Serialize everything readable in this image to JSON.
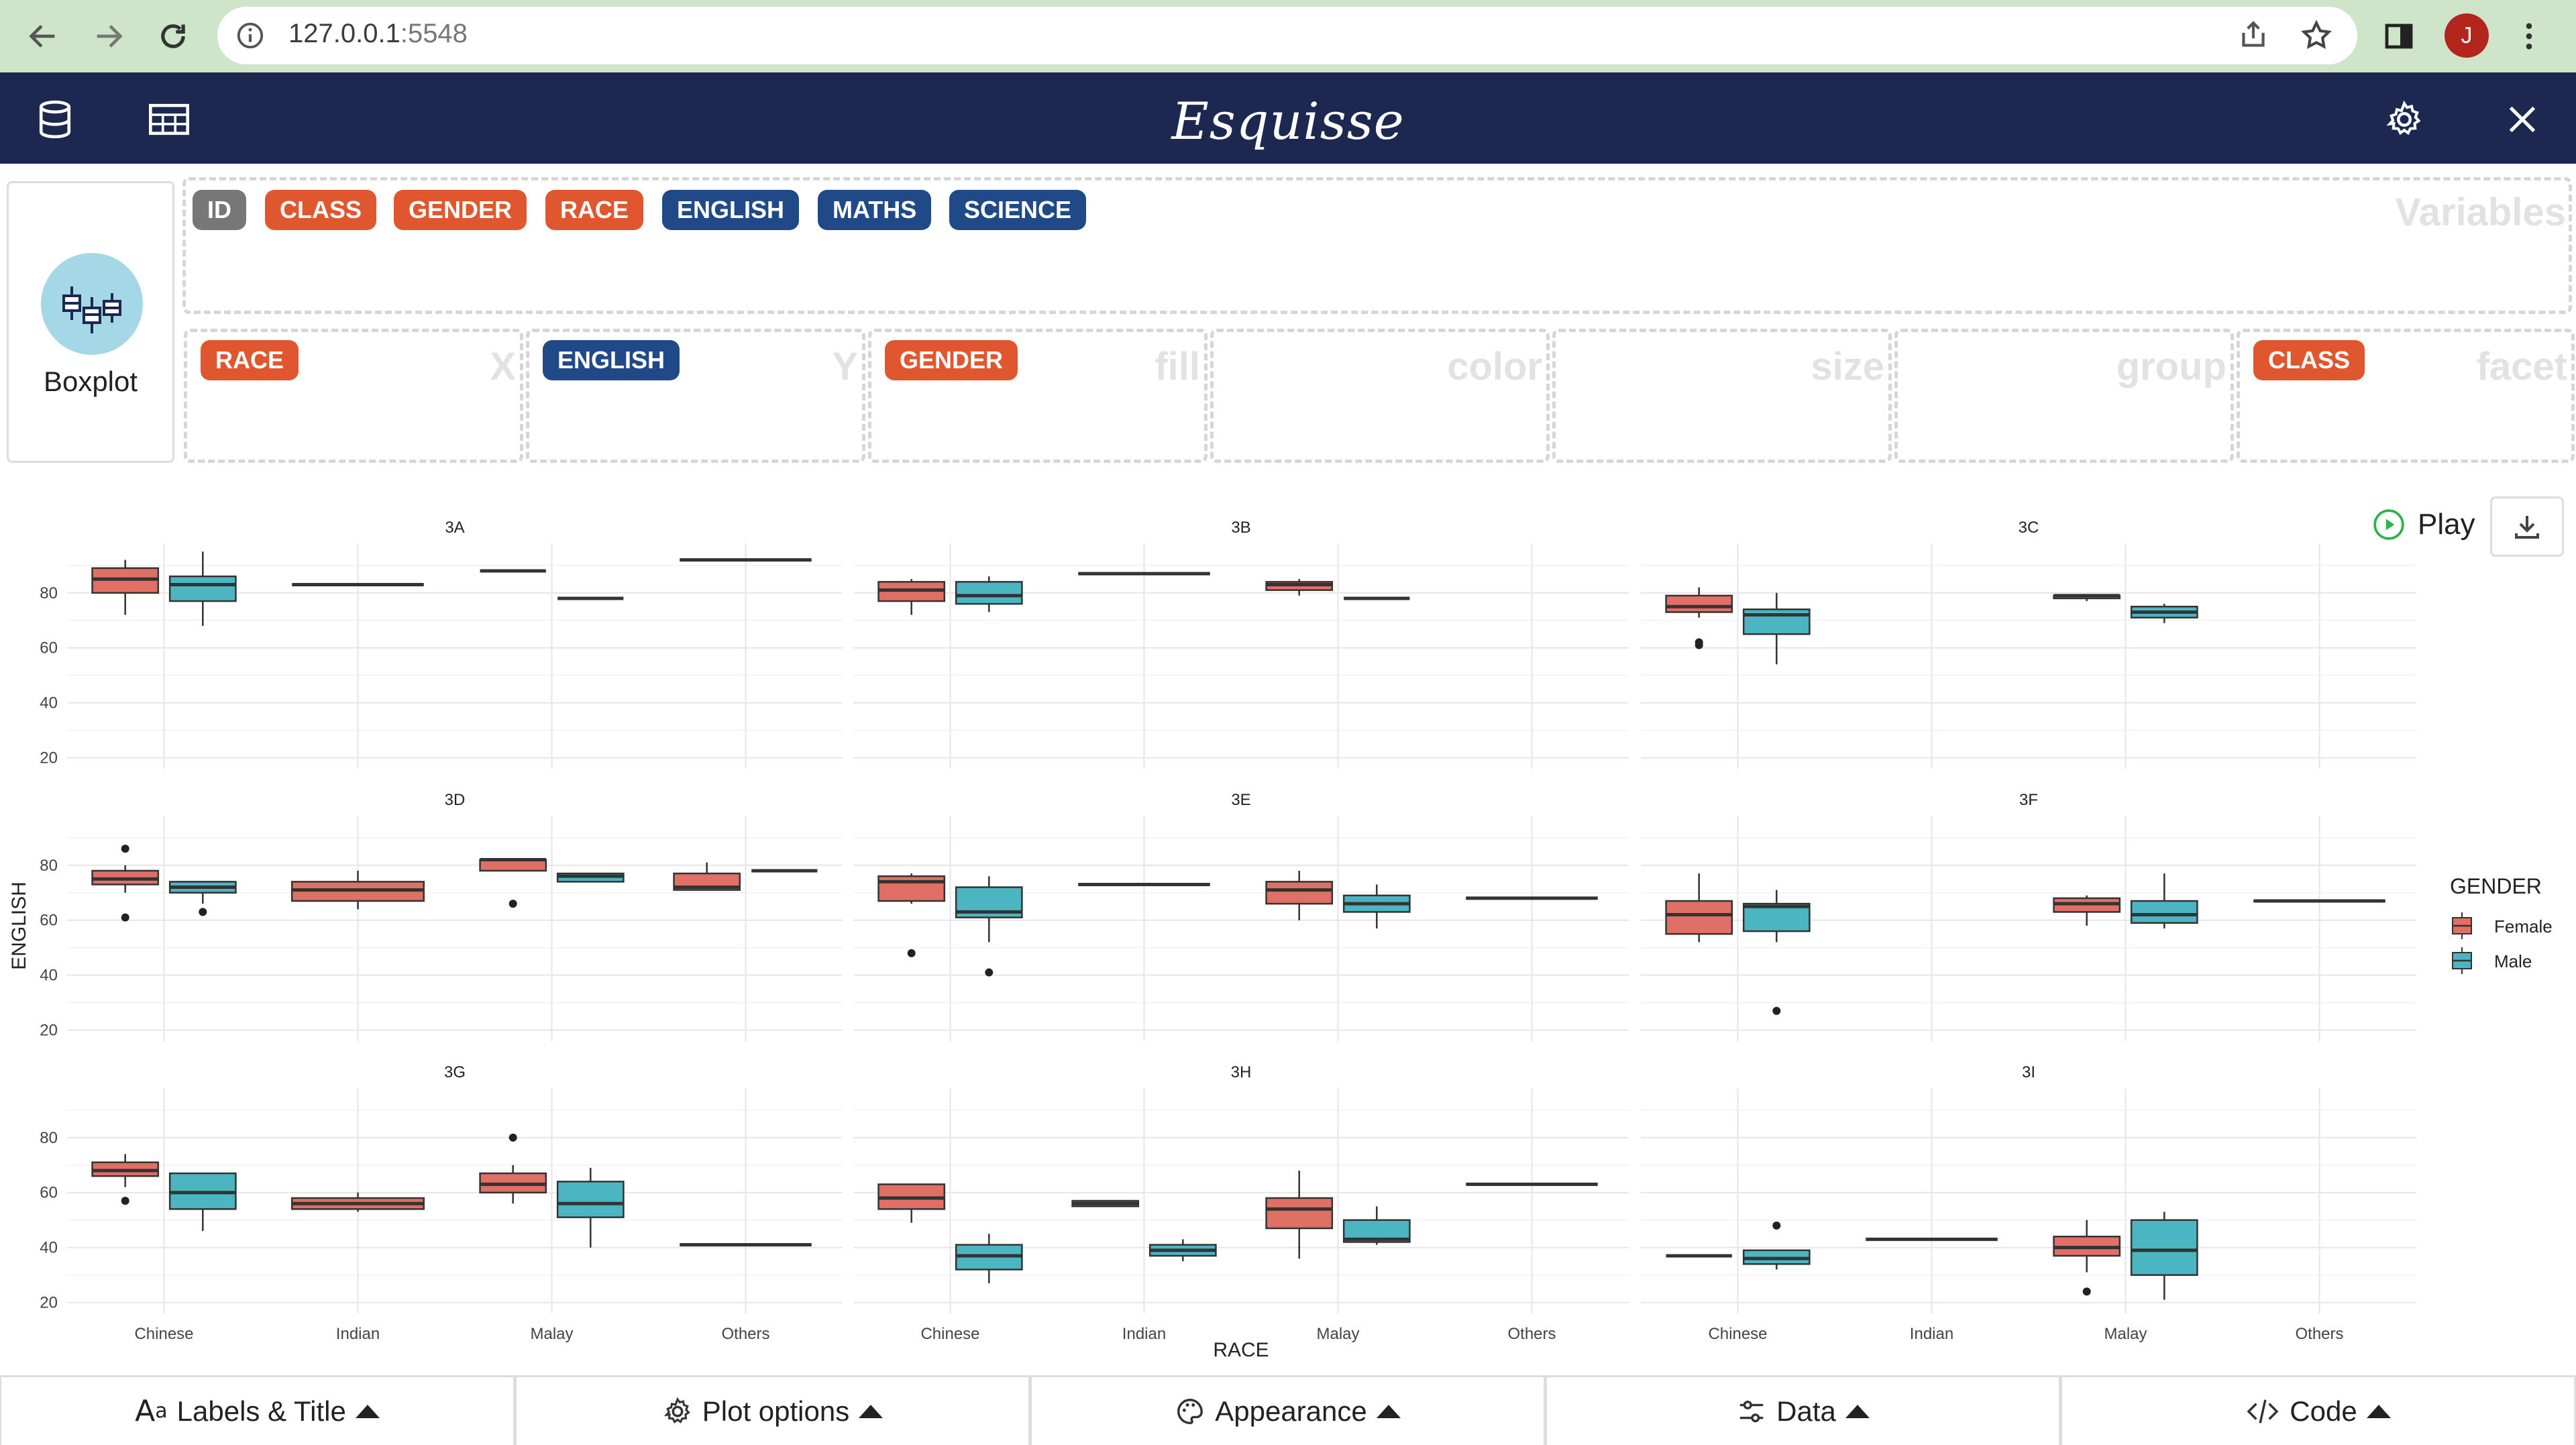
{
  "browser": {
    "url_host": "127.0.0.1",
    "url_port": ":5548",
    "avatar_letter": "J"
  },
  "app": {
    "title": "Esquisse"
  },
  "geom": {
    "label": "Boxplot"
  },
  "variables": {
    "title": "Variables",
    "items": [
      {
        "name": "ID",
        "kind": "id",
        "color": "#777777"
      },
      {
        "name": "CLASS",
        "kind": "discrete",
        "color": "#e0572f"
      },
      {
        "name": "GENDER",
        "kind": "discrete",
        "color": "#e0572f"
      },
      {
        "name": "RACE",
        "kind": "discrete",
        "color": "#e0572f"
      },
      {
        "name": "ENGLISH",
        "kind": "continuous",
        "color": "#204a87"
      },
      {
        "name": "MATHS",
        "kind": "continuous",
        "color": "#204a87"
      },
      {
        "name": "SCIENCE",
        "kind": "continuous",
        "color": "#204a87"
      }
    ]
  },
  "mappings": [
    {
      "title": "X",
      "value": "RACE",
      "kind": "discrete"
    },
    {
      "title": "Y",
      "value": "ENGLISH",
      "kind": "continuous"
    },
    {
      "title": "fill",
      "value": "GENDER",
      "kind": "discrete"
    },
    {
      "title": "color",
      "value": "",
      "kind": ""
    },
    {
      "title": "size",
      "value": "",
      "kind": ""
    },
    {
      "title": "group",
      "value": "",
      "kind": ""
    },
    {
      "title": "facet",
      "value": "CLASS",
      "kind": "discrete"
    }
  ],
  "controls": {
    "play_label": "Play"
  },
  "bottom_bar": [
    {
      "label": "Labels & Title",
      "icon": "text-aa-icon"
    },
    {
      "label": "Plot options",
      "icon": "gear-icon"
    },
    {
      "label": "Appearance",
      "icon": "palette-icon"
    },
    {
      "label": "Data",
      "icon": "sliders-icon"
    },
    {
      "label": "Code",
      "icon": "code-icon"
    }
  ],
  "chart_data": {
    "type": "boxplot",
    "xlabel": "RACE",
    "ylabel": "ENGLISH",
    "categories": [
      "Chinese",
      "Indian",
      "Malay",
      "Others"
    ],
    "yticks": [
      20,
      40,
      60,
      80
    ],
    "ylim": [
      16,
      98
    ],
    "legend": {
      "title": "GENDER",
      "placement": "right",
      "entries": [
        {
          "name": "Female",
          "color": "#e07066"
        },
        {
          "name": "Male",
          "color": "#4bb5c1"
        }
      ]
    },
    "facets": [
      {
        "title": "3A",
        "boxes": [
          {
            "cat": "Chinese",
            "group": "Female",
            "min": 72,
            "q1": 80,
            "med": 85,
            "q3": 89,
            "max": 92,
            "outliers": []
          },
          {
            "cat": "Chinese",
            "group": "Male",
            "min": 68,
            "q1": 77,
            "med": 83,
            "q3": 86,
            "max": 95,
            "outliers": []
          },
          {
            "cat": "Indian",
            "group": "",
            "min": 83,
            "q1": 83,
            "med": 83,
            "q3": 83,
            "max": 83,
            "outliers": []
          },
          {
            "cat": "Malay",
            "group": "Female",
            "min": 88,
            "q1": 88,
            "med": 88,
            "q3": 88,
            "max": 88,
            "outliers": []
          },
          {
            "cat": "Malay",
            "group": "Male",
            "min": 78,
            "q1": 78,
            "med": 78,
            "q3": 78,
            "max": 78,
            "outliers": []
          },
          {
            "cat": "Others",
            "group": "",
            "min": 92,
            "q1": 92,
            "med": 92,
            "q3": 92,
            "max": 92,
            "outliers": []
          }
        ]
      },
      {
        "title": "3B",
        "boxes": [
          {
            "cat": "Chinese",
            "group": "Female",
            "min": 72,
            "q1": 77,
            "med": 81,
            "q3": 84,
            "max": 85,
            "outliers": []
          },
          {
            "cat": "Chinese",
            "group": "Male",
            "min": 73,
            "q1": 76,
            "med": 79,
            "q3": 84,
            "max": 86,
            "outliers": []
          },
          {
            "cat": "Indian",
            "group": "",
            "min": 87,
            "q1": 87,
            "med": 87,
            "q3": 87,
            "max": 87,
            "outliers": []
          },
          {
            "cat": "Malay",
            "group": "Female",
            "min": 79,
            "q1": 81,
            "med": 83,
            "q3": 84,
            "max": 85,
            "outliers": []
          },
          {
            "cat": "Malay",
            "group": "Male",
            "min": 78,
            "q1": 78,
            "med": 78,
            "q3": 78,
            "max": 78,
            "outliers": []
          }
        ]
      },
      {
        "title": "3C",
        "boxes": [
          {
            "cat": "Chinese",
            "group": "Female",
            "min": 71,
            "q1": 73,
            "med": 75,
            "q3": 79,
            "max": 82,
            "outliers": [
              62,
              61
            ]
          },
          {
            "cat": "Chinese",
            "group": "Male",
            "min": 54,
            "q1": 65,
            "med": 72,
            "q3": 74,
            "max": 80,
            "outliers": []
          },
          {
            "cat": "Malay",
            "group": "Female",
            "min": 77,
            "q1": 78,
            "med": 79,
            "q3": 79,
            "max": 79,
            "outliers": []
          },
          {
            "cat": "Malay",
            "group": "Male",
            "min": 69,
            "q1": 71,
            "med": 73,
            "q3": 75,
            "max": 76,
            "outliers": []
          }
        ]
      },
      {
        "title": "3D",
        "boxes": [
          {
            "cat": "Chinese",
            "group": "Female",
            "min": 70,
            "q1": 73,
            "med": 75,
            "q3": 78,
            "max": 80,
            "outliers": [
              86,
              61
            ]
          },
          {
            "cat": "Chinese",
            "group": "Male",
            "min": 66,
            "q1": 70,
            "med": 72,
            "q3": 74,
            "max": 74,
            "outliers": [
              63
            ]
          },
          {
            "cat": "Indian",
            "group": "",
            "min": 64,
            "q1": 67,
            "med": 71,
            "q3": 74,
            "max": 78,
            "outliers": []
          },
          {
            "cat": "Malay",
            "group": "Female",
            "min": 78,
            "q1": 78,
            "med": 82,
            "q3": 82,
            "max": 82,
            "outliers": [
              66
            ]
          },
          {
            "cat": "Malay",
            "group": "Male",
            "min": 74,
            "q1": 74,
            "med": 76,
            "q3": 77,
            "max": 77,
            "outliers": []
          },
          {
            "cat": "Others",
            "group": "Female",
            "min": 71,
            "q1": 71,
            "med": 72,
            "q3": 77,
            "max": 81,
            "outliers": []
          },
          {
            "cat": "Others",
            "group": "Male",
            "min": 78,
            "q1": 78,
            "med": 78,
            "q3": 78,
            "max": 78,
            "outliers": []
          }
        ]
      },
      {
        "title": "3E",
        "boxes": [
          {
            "cat": "Chinese",
            "group": "Female",
            "min": 66,
            "q1": 67,
            "med": 74,
            "q3": 76,
            "max": 77,
            "outliers": [
              48
            ]
          },
          {
            "cat": "Chinese",
            "group": "Male",
            "min": 52,
            "q1": 61,
            "med": 63,
            "q3": 72,
            "max": 76,
            "outliers": [
              41
            ]
          },
          {
            "cat": "Indian",
            "group": "",
            "min": 73,
            "q1": 73,
            "med": 73,
            "q3": 73,
            "max": 73,
            "outliers": []
          },
          {
            "cat": "Malay",
            "group": "Female",
            "min": 60,
            "q1": 66,
            "med": 71,
            "q3": 74,
            "max": 78,
            "outliers": []
          },
          {
            "cat": "Malay",
            "group": "Male",
            "min": 57,
            "q1": 63,
            "med": 66,
            "q3": 69,
            "max": 73,
            "outliers": []
          },
          {
            "cat": "Others",
            "group": "",
            "min": 68,
            "q1": 68,
            "med": 68,
            "q3": 68,
            "max": 68,
            "outliers": []
          }
        ]
      },
      {
        "title": "3F",
        "boxes": [
          {
            "cat": "Chinese",
            "group": "Female",
            "min": 52,
            "q1": 55,
            "med": 62,
            "q3": 67,
            "max": 77,
            "outliers": []
          },
          {
            "cat": "Chinese",
            "group": "Male",
            "min": 52,
            "q1": 56,
            "med": 65,
            "q3": 66,
            "max": 71,
            "outliers": [
              27
            ]
          },
          {
            "cat": "Malay",
            "group": "Female",
            "min": 58,
            "q1": 63,
            "med": 66,
            "q3": 68,
            "max": 69,
            "outliers": []
          },
          {
            "cat": "Malay",
            "group": "Male",
            "min": 57,
            "q1": 59,
            "med": 62,
            "q3": 67,
            "max": 77,
            "outliers": []
          },
          {
            "cat": "Others",
            "group": "",
            "min": 67,
            "q1": 67,
            "med": 67,
            "q3": 67,
            "max": 67,
            "outliers": []
          }
        ]
      },
      {
        "title": "3G",
        "boxes": [
          {
            "cat": "Chinese",
            "group": "Female",
            "min": 62,
            "q1": 66,
            "med": 68,
            "q3": 71,
            "max": 74,
            "outliers": [
              57
            ]
          },
          {
            "cat": "Chinese",
            "group": "Male",
            "min": 46,
            "q1": 54,
            "med": 60,
            "q3": 67,
            "max": 67,
            "outliers": []
          },
          {
            "cat": "Indian",
            "group": "",
            "min": 53,
            "q1": 54,
            "med": 56,
            "q3": 58,
            "max": 60,
            "outliers": []
          },
          {
            "cat": "Malay",
            "group": "Female",
            "min": 56,
            "q1": 60,
            "med": 63,
            "q3": 67,
            "max": 70,
            "outliers": [
              80
            ]
          },
          {
            "cat": "Malay",
            "group": "Male",
            "min": 40,
            "q1": 51,
            "med": 56,
            "q3": 64,
            "max": 69,
            "outliers": []
          },
          {
            "cat": "Others",
            "group": "",
            "min": 41,
            "q1": 41,
            "med": 41,
            "q3": 41,
            "max": 41,
            "outliers": []
          }
        ]
      },
      {
        "title": "3H",
        "boxes": [
          {
            "cat": "Chinese",
            "group": "Female",
            "min": 49,
            "q1": 54,
            "med": 58,
            "q3": 63,
            "max": 63,
            "outliers": []
          },
          {
            "cat": "Chinese",
            "group": "Male",
            "min": 27,
            "q1": 32,
            "med": 37,
            "q3": 41,
            "max": 45,
            "outliers": []
          },
          {
            "cat": "Indian",
            "group": "Female",
            "min": 55,
            "q1": 55,
            "med": 56,
            "q3": 57,
            "max": 57,
            "outliers": []
          },
          {
            "cat": "Indian",
            "group": "Male",
            "min": 35,
            "q1": 37,
            "med": 39,
            "q3": 41,
            "max": 43,
            "outliers": []
          },
          {
            "cat": "Malay",
            "group": "Female",
            "min": 36,
            "q1": 47,
            "med": 54,
            "q3": 58,
            "max": 68,
            "outliers": []
          },
          {
            "cat": "Malay",
            "group": "Male",
            "min": 41,
            "q1": 42,
            "med": 43,
            "q3": 50,
            "max": 55,
            "outliers": []
          },
          {
            "cat": "Others",
            "group": "",
            "min": 63,
            "q1": 63,
            "med": 63,
            "q3": 63,
            "max": 63,
            "outliers": []
          }
        ]
      },
      {
        "title": "3I",
        "boxes": [
          {
            "cat": "Chinese",
            "group": "Female",
            "min": 37,
            "q1": 37,
            "med": 37,
            "q3": 37,
            "max": 37,
            "outliers": []
          },
          {
            "cat": "Chinese",
            "group": "Male",
            "min": 32,
            "q1": 34,
            "med": 36,
            "q3": 39,
            "max": 39,
            "outliers": [
              48
            ]
          },
          {
            "cat": "Indian",
            "group": "",
            "min": 43,
            "q1": 43,
            "med": 43,
            "q3": 43,
            "max": 43,
            "outliers": []
          },
          {
            "cat": "Malay",
            "group": "Female",
            "min": 31,
            "q1": 37,
            "med": 40,
            "q3": 44,
            "max": 50,
            "outliers": [
              24
            ]
          },
          {
            "cat": "Malay",
            "group": "Male",
            "min": 21,
            "q1": 30,
            "med": 39,
            "q3": 50,
            "max": 53,
            "outliers": []
          }
        ]
      }
    ]
  }
}
